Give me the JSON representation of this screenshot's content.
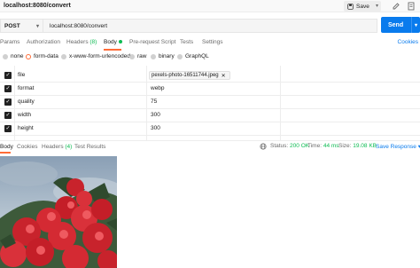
{
  "title_bar": {
    "title": "localhost:8080/convert",
    "save_label": "Save"
  },
  "request": {
    "method": "POST",
    "url": "localhost:8080/convert",
    "send_label": "Send"
  },
  "request_tabs": [
    {
      "label": "Params"
    },
    {
      "label": "Authorization"
    },
    {
      "label": "Headers",
      "count": "(8)"
    },
    {
      "label": "Body"
    },
    {
      "label": "Pre-request Script"
    },
    {
      "label": "Tests"
    },
    {
      "label": "Settings"
    }
  ],
  "cookies_label": "Cookies",
  "body_types": {
    "options": [
      "none",
      "form-data",
      "x-www-form-urlencoded",
      "raw",
      "binary",
      "GraphQL"
    ],
    "selected": "form-data"
  },
  "form_rows": [
    {
      "key": "file",
      "value": "pexels-photo-16511744.jpeg",
      "is_file": true
    },
    {
      "key": "format",
      "value": "webp"
    },
    {
      "key": "quality",
      "value": "75"
    },
    {
      "key": "width",
      "value": "300"
    },
    {
      "key": "height",
      "value": "300"
    }
  ],
  "response_tabs": [
    {
      "label": "Body"
    },
    {
      "label": "Cookies"
    },
    {
      "label": "Headers",
      "count": "(4)"
    },
    {
      "label": "Test Results"
    }
  ],
  "response_meta": {
    "status_label": "Status:",
    "status_value": "200 OK",
    "time_label": "Time:",
    "time_value": "44 ms",
    "size_label": "Size:",
    "size_value": "19.08 KB",
    "save_response_label": "Save Response"
  },
  "colors": {
    "accent": "#ff6c37",
    "primary": "#097bed",
    "success": "#0cbb52"
  }
}
